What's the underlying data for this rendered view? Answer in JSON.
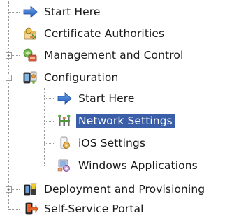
{
  "tree": {
    "items": [
      {
        "label": "Start Here",
        "icon": "arrow-right-icon",
        "level": 0,
        "expander": null
      },
      {
        "label": "Certificate Authorities",
        "icon": "certificate-icon",
        "level": 0,
        "expander": null
      },
      {
        "label": "Management and Control",
        "icon": "management-icon",
        "level": 0,
        "expander": "+"
      },
      {
        "label": "Configuration",
        "icon": "configuration-icon",
        "level": 0,
        "expander": "-"
      },
      {
        "label": "Start Here",
        "icon": "arrow-right-icon",
        "level": 1,
        "expander": null
      },
      {
        "label": "Network Settings",
        "icon": "network-icon",
        "level": 1,
        "expander": null,
        "selected": true
      },
      {
        "label": "iOS Settings",
        "icon": "ios-settings-icon",
        "level": 1,
        "expander": null
      },
      {
        "label": "Windows Applications",
        "icon": "windows-apps-icon",
        "level": 1,
        "expander": null
      },
      {
        "label": "Deployment and Provisioning",
        "icon": "deployment-icon",
        "level": 0,
        "expander": "+"
      },
      {
        "label": "Self-Service Portal",
        "icon": "portal-icon",
        "level": 0,
        "expander": null
      }
    ]
  },
  "colors": {
    "selection_bg": "#3b5ea8",
    "selection_text": "#ffffff",
    "guide_line": "#9a9a9a"
  }
}
